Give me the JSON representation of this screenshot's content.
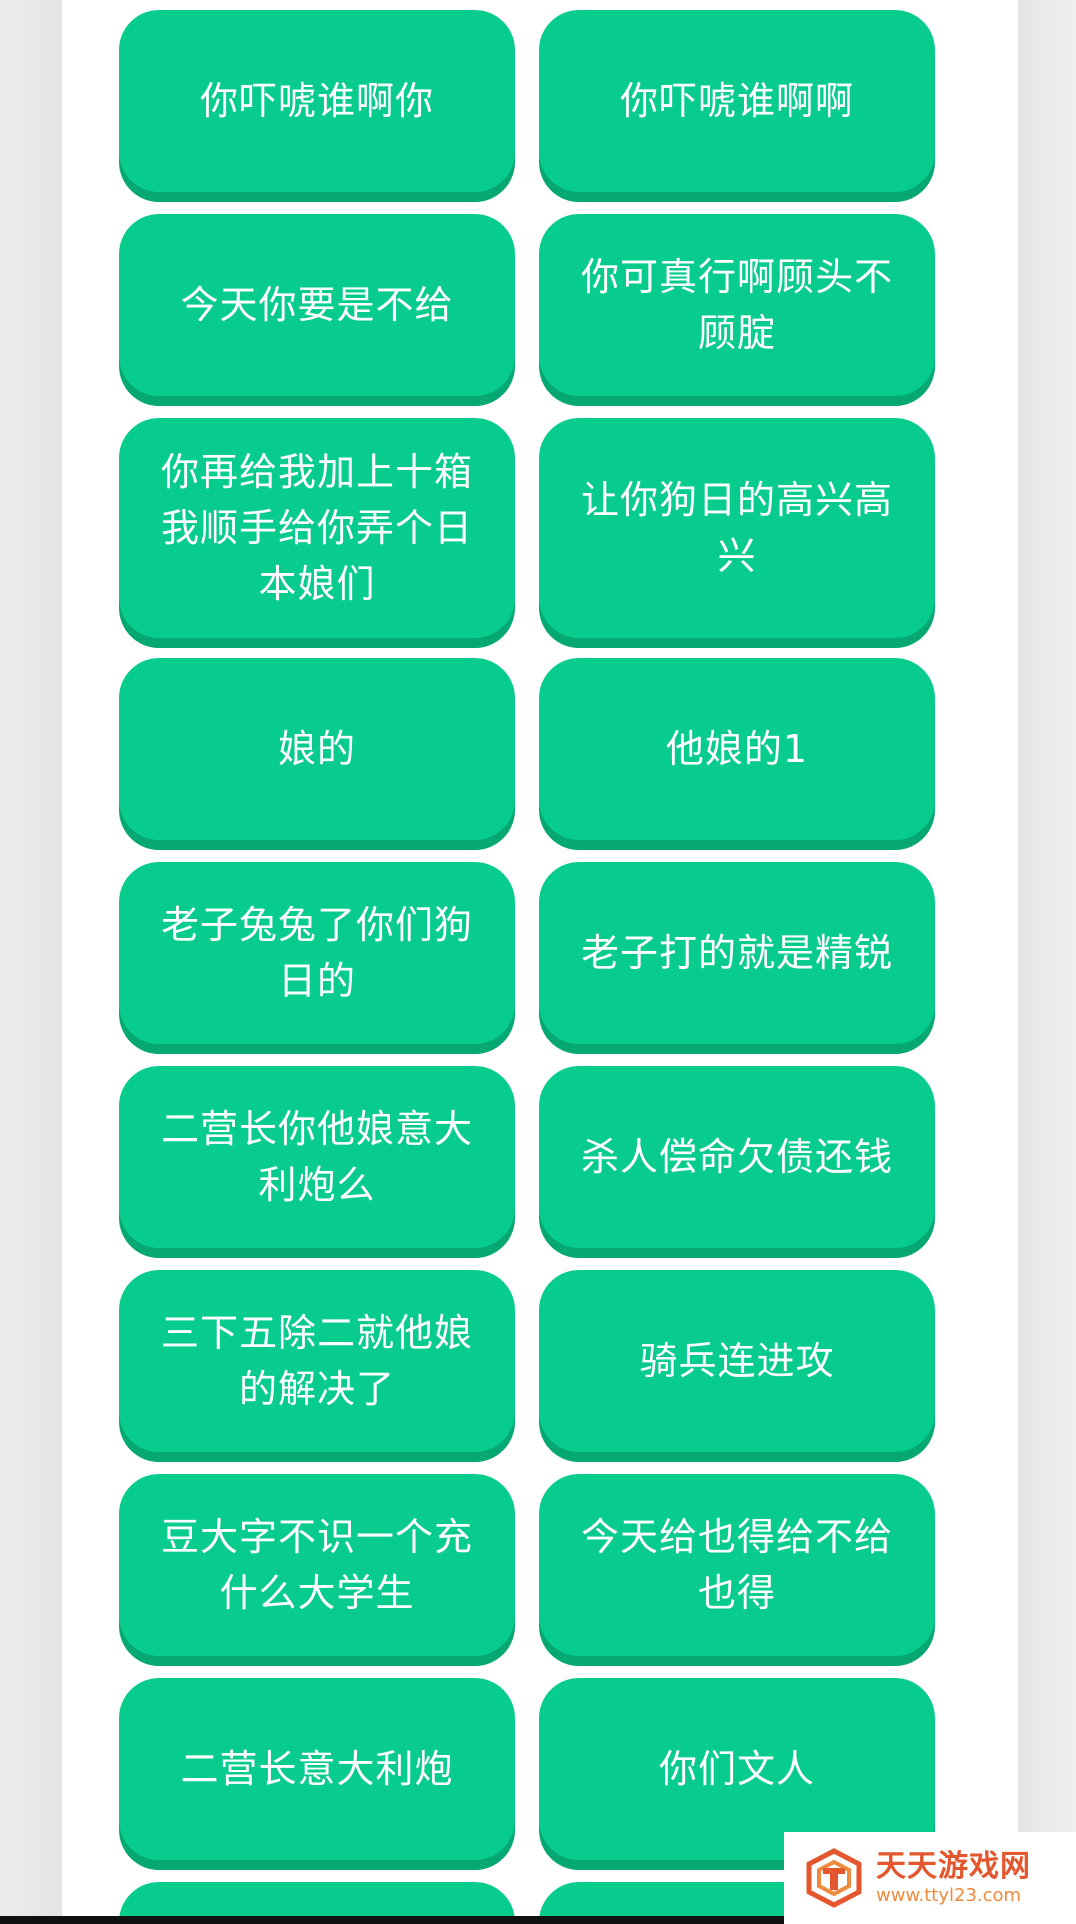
{
  "buttons": [
    {
      "label": "你吓唬谁啊你"
    },
    {
      "label": "你吓唬谁啊啊"
    },
    {
      "label": "今天你要是不给"
    },
    {
      "label": "你可真行啊顾头不顾腚"
    },
    {
      "label": "你再给我加上十箱我顺手给你弄个日本娘们"
    },
    {
      "label": "让你狗日的高兴高兴"
    },
    {
      "label": "娘的"
    },
    {
      "label": "他娘的1"
    },
    {
      "label": "老子兔兔了你们狗日的"
    },
    {
      "label": "老子打的就是精锐"
    },
    {
      "label": "二营长你他娘意大利炮么"
    },
    {
      "label": "杀人偿命欠债还钱"
    },
    {
      "label": "三下五除二就他娘的解决了"
    },
    {
      "label": "骑兵连进攻"
    },
    {
      "label": "豆大字不识一个充什么大学生"
    },
    {
      "label": "今天给也得给不给也得"
    },
    {
      "label": "二营长意大利炮"
    },
    {
      "label": "你们文人"
    },
    {
      "label": ""
    },
    {
      "label": ""
    }
  ],
  "watermark": {
    "title": "天天游戏网",
    "url": "www.ttyl23.com"
  },
  "colors": {
    "button": "#08cc8e",
    "button_shadow": "#05a872",
    "text": "#ffffff"
  }
}
